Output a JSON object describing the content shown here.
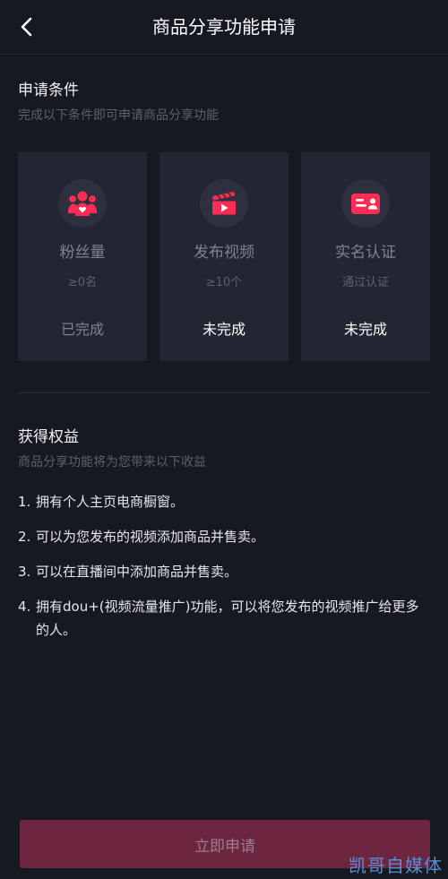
{
  "header": {
    "title": "商品分享功能申请",
    "back_icon": "chevron-left-icon"
  },
  "conditions": {
    "title": "申请条件",
    "subtitle": "完成以下条件即可申请商品分享功能",
    "cards": [
      {
        "icon": "fans-group-icon",
        "name": "粉丝量",
        "requirement": "≥0名",
        "status": "已完成"
      },
      {
        "icon": "video-clapper-icon",
        "name": "发布视频",
        "requirement": "≥10个",
        "status": "未完成"
      },
      {
        "icon": "id-card-icon",
        "name": "实名认证",
        "requirement": "通过认证",
        "status": "未完成"
      }
    ]
  },
  "benefits": {
    "title": "获得权益",
    "subtitle": "商品分享功能将为您带来以下收益",
    "items": [
      {
        "num": "1.",
        "text": "拥有个人主页电商橱窗。"
      },
      {
        "num": "2.",
        "text": "可以为您发布的视频添加商品并售卖。"
      },
      {
        "num": "3.",
        "text": "可以在直播间中添加商品并售卖。"
      },
      {
        "num": "4.",
        "text": "拥有dou+(视频流量推广)功能，可以将您发布的视频推广给更多的人。"
      }
    ]
  },
  "apply_button": {
    "label": "立即申请"
  },
  "watermark": "凯哥自媒体",
  "colors": {
    "background": "#161822",
    "card": "#232532",
    "icon_accent": "#fe2c55",
    "button": "#6e2540"
  }
}
